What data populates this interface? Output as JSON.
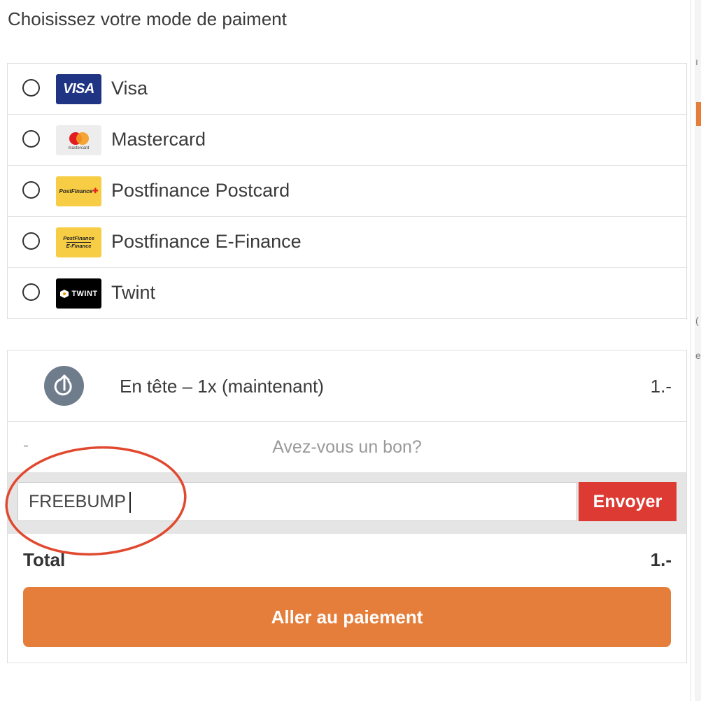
{
  "page": {
    "title": "Choisissez votre mode de paiment"
  },
  "payment_methods": [
    {
      "label": "Visa",
      "logo_text": "VISA",
      "icon": "visa-logo"
    },
    {
      "label": "Mastercard",
      "logo_text": "mastercard",
      "icon": "mastercard-logo"
    },
    {
      "label": "Postfinance Postcard",
      "logo_text": "PostFinance",
      "icon": "postfinance-logo"
    },
    {
      "label": "Postfinance E-Finance",
      "logo_text": "PostFinance",
      "logo_text_2": "E-Finance",
      "icon": "postfinance-efinance-logo"
    },
    {
      "label": "Twint",
      "logo_text": "TWINT",
      "icon": "twint-logo"
    }
  ],
  "order": {
    "item_label": "En tête – 1x (maintenant)",
    "item_price": "1.-",
    "item_icon": "bump-up-arrow-icon"
  },
  "voucher": {
    "toggle_prefix": "-",
    "toggle_label": "Avez-vous un bon?",
    "input_value": "FREEBUMP",
    "submit_label": "Envoyer"
  },
  "total": {
    "label": "Total",
    "value": "1.-"
  },
  "checkout": {
    "button_label": "Aller au paiement"
  },
  "colors": {
    "accent_orange": "#e57e3a",
    "submit_red": "#dc3a32",
    "annotation_red": "#e0492f",
    "visa_blue": "#1f3583",
    "postfinance_yellow": "#f7cd46"
  }
}
